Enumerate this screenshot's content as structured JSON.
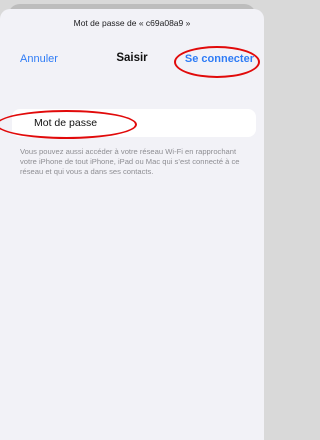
{
  "header": {
    "title": "Mot de passe de « c69a08a9 »",
    "cancel_label": "Annuler",
    "center_label": "Saisir",
    "connect_label": "Se connecter"
  },
  "form": {
    "password_label": "Mot de passe",
    "help_text": "Vous pouvez aussi accéder à votre réseau Wi-Fi en rapprochant votre iPhone de tout iPhone, iPad ou Mac qui s’est connecté à ce réseau et qui vous a dans ses contacts."
  },
  "colors": {
    "accent": "#2f7cf6",
    "annotation": "#e10a0a",
    "background": "#f2f2f7"
  }
}
